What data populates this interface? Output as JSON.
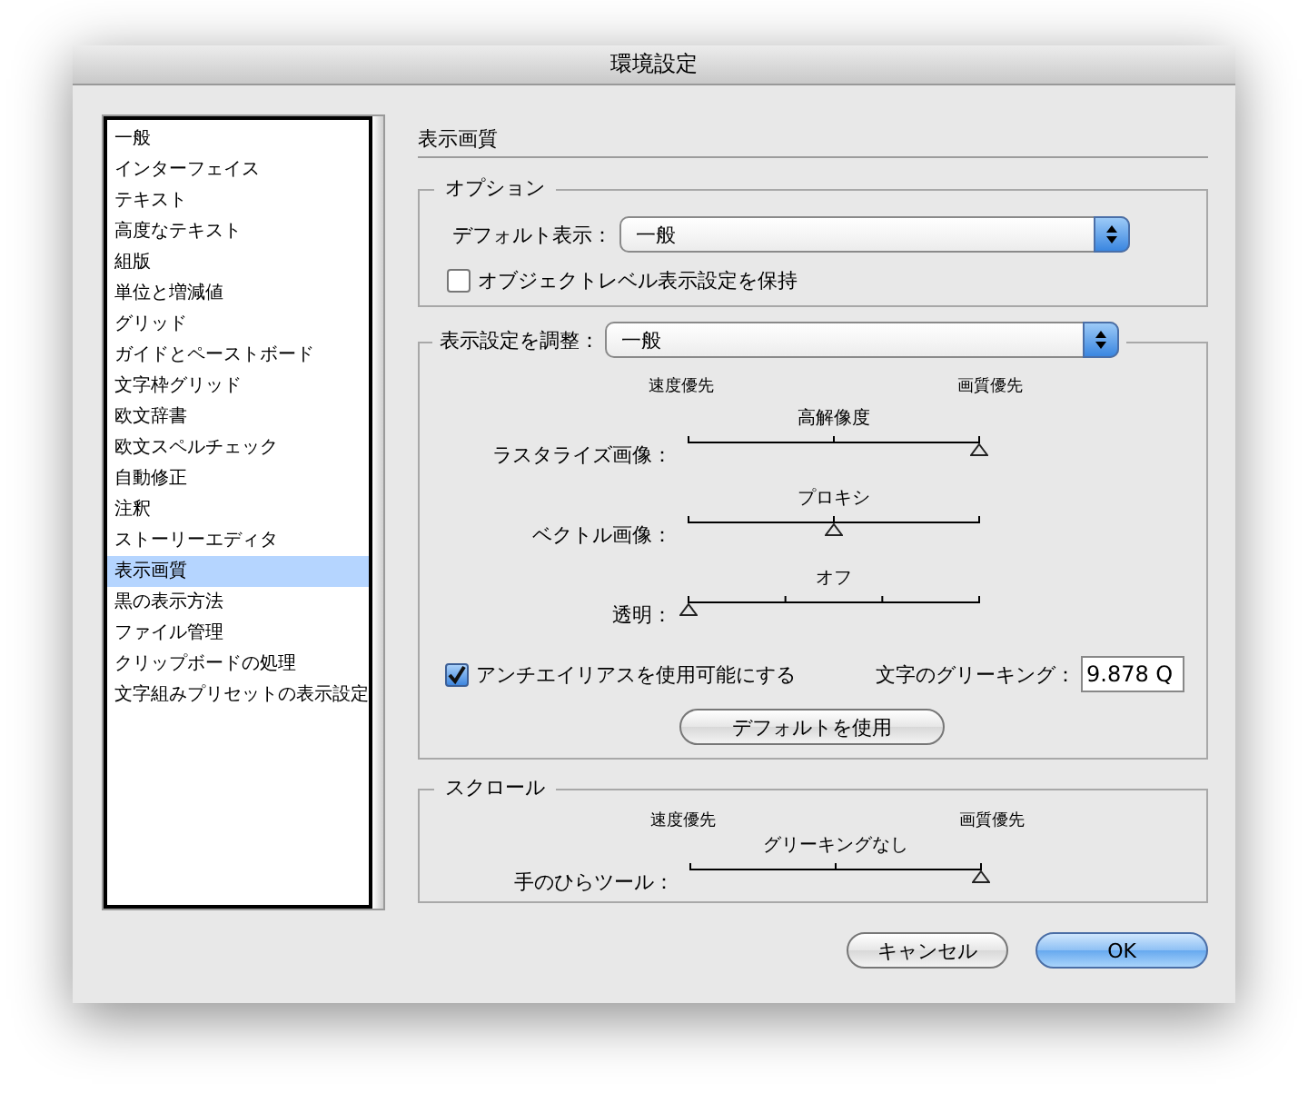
{
  "window": {
    "title": "環境設定"
  },
  "sidebar": {
    "items": [
      {
        "label": "一般",
        "selected": false
      },
      {
        "label": "インターフェイス",
        "selected": false
      },
      {
        "label": "テキスト",
        "selected": false
      },
      {
        "label": "高度なテキスト",
        "selected": false
      },
      {
        "label": "組版",
        "selected": false
      },
      {
        "label": "単位と増減値",
        "selected": false
      },
      {
        "label": "グリッド",
        "selected": false
      },
      {
        "label": "ガイドとペーストボード",
        "selected": false
      },
      {
        "label": "文字枠グリッド",
        "selected": false
      },
      {
        "label": "欧文辞書",
        "selected": false
      },
      {
        "label": "欧文スペルチェック",
        "selected": false
      },
      {
        "label": "自動修正",
        "selected": false
      },
      {
        "label": "注釈",
        "selected": false
      },
      {
        "label": "ストーリーエディタ",
        "selected": false
      },
      {
        "label": "表示画質",
        "selected": true
      },
      {
        "label": "黒の表示方法",
        "selected": false
      },
      {
        "label": "ファイル管理",
        "selected": false
      },
      {
        "label": "クリップボードの処理",
        "selected": false
      },
      {
        "label": "文字組みプリセットの表示設定",
        "selected": false
      }
    ]
  },
  "section_title": "表示画質",
  "options": {
    "legend": "オプション",
    "default_view": {
      "label": "デフォルト表示：",
      "value": "一般"
    },
    "keep_object_settings": {
      "label": "オブジェクトレベル表示設定を保持",
      "checked": false
    }
  },
  "adjust": {
    "label": "表示設定を調整：",
    "value": "一般",
    "scale_left": "速度優先",
    "scale_right": "画質優先",
    "sliders": [
      {
        "label": "ラスタライズ画像：",
        "reading": "高解像度",
        "level": 1,
        "kind": "three"
      },
      {
        "label": "ベクトル画像：",
        "reading": "プロキシ",
        "level": 0.5,
        "kind": "three"
      },
      {
        "label": "透明：",
        "reading": "オフ",
        "level": 0,
        "kind": "four"
      }
    ],
    "antialias": {
      "label": "アンチエイリアスを使用可能にする",
      "checked": true
    },
    "greeking": {
      "label": "文字のグリーキング：",
      "value": "9.878 Q"
    },
    "default_button": "デフォルトを使用"
  },
  "scrolling": {
    "legend": "スクロール",
    "scale_left": "速度優先",
    "scale_right": "画質優先",
    "sliders": [
      {
        "label": "手のひらツール：",
        "reading": "グリーキングなし",
        "level": 1,
        "kind": "three"
      }
    ]
  },
  "buttons": [
    {
      "label": "キャンセル",
      "kind": "cancel"
    },
    {
      "label": "OK",
      "kind": "default"
    }
  ]
}
